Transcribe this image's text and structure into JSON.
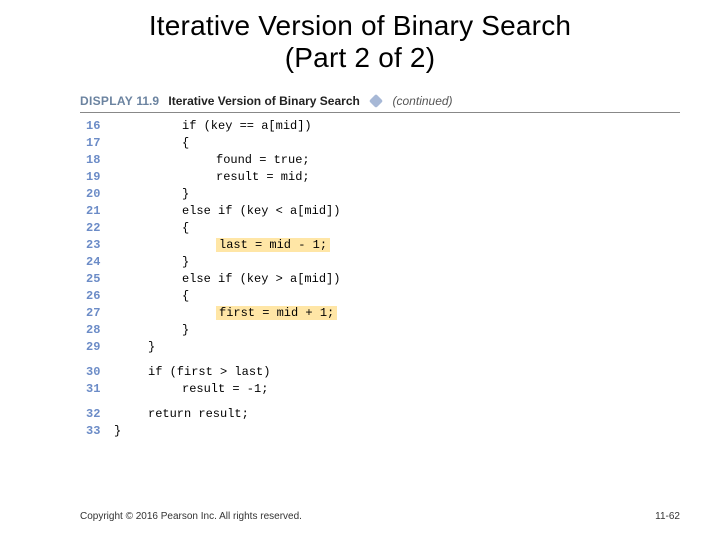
{
  "title_line1": "Iterative Version of Binary Search",
  "title_line2": "(Part 2 of 2)",
  "display": {
    "label": "Display",
    "number": "11.9",
    "title": "Iterative Version of Binary Search",
    "continued": "(continued)"
  },
  "code": {
    "rows": [
      {
        "ln": "16",
        "indent": "ind2",
        "text": "if (key == a[mid])",
        "hl": false
      },
      {
        "ln": "17",
        "indent": "ind2",
        "text": "{",
        "hl": false
      },
      {
        "ln": "18",
        "indent": "ind3",
        "text": "found = true;",
        "hl": false
      },
      {
        "ln": "19",
        "indent": "ind3",
        "text": "result = mid;",
        "hl": false
      },
      {
        "ln": "20",
        "indent": "ind2",
        "text": "}",
        "hl": false
      },
      {
        "ln": "21",
        "indent": "ind2",
        "text": "else if (key < a[mid])",
        "hl": false
      },
      {
        "ln": "22",
        "indent": "ind2",
        "text": "{",
        "hl": false
      },
      {
        "ln": "23",
        "indent": "ind3",
        "text": "last = mid - 1;",
        "hl": true
      },
      {
        "ln": "24",
        "indent": "ind2",
        "text": "}",
        "hl": false
      },
      {
        "ln": "25",
        "indent": "ind2",
        "text": "else if (key > a[mid])",
        "hl": false
      },
      {
        "ln": "26",
        "indent": "ind2",
        "text": "{",
        "hl": false
      },
      {
        "ln": "27",
        "indent": "ind3",
        "text": "first = mid + 1;",
        "hl": true
      },
      {
        "ln": "28",
        "indent": "ind2",
        "text": "}",
        "hl": false
      },
      {
        "ln": "29",
        "indent": "ind1",
        "text": "}",
        "hl": false
      },
      {
        "ln": "",
        "indent": "ind1",
        "text": "",
        "hl": false,
        "spacer": true
      },
      {
        "ln": "30",
        "indent": "ind1",
        "text": "if (first > last)",
        "hl": false
      },
      {
        "ln": "31",
        "indent": "ind2",
        "text": "result = -1;",
        "hl": false
      },
      {
        "ln": "",
        "indent": "ind1",
        "text": "",
        "hl": false,
        "spacer": true
      },
      {
        "ln": "32",
        "indent": "ind1",
        "text": "return result;",
        "hl": false
      },
      {
        "ln": "33",
        "indent": "ind0",
        "text": "}",
        "hl": false
      }
    ]
  },
  "footer": {
    "copyright": "Copyright © 2016 Pearson Inc. All rights reserved.",
    "pagenum": "11-62"
  }
}
